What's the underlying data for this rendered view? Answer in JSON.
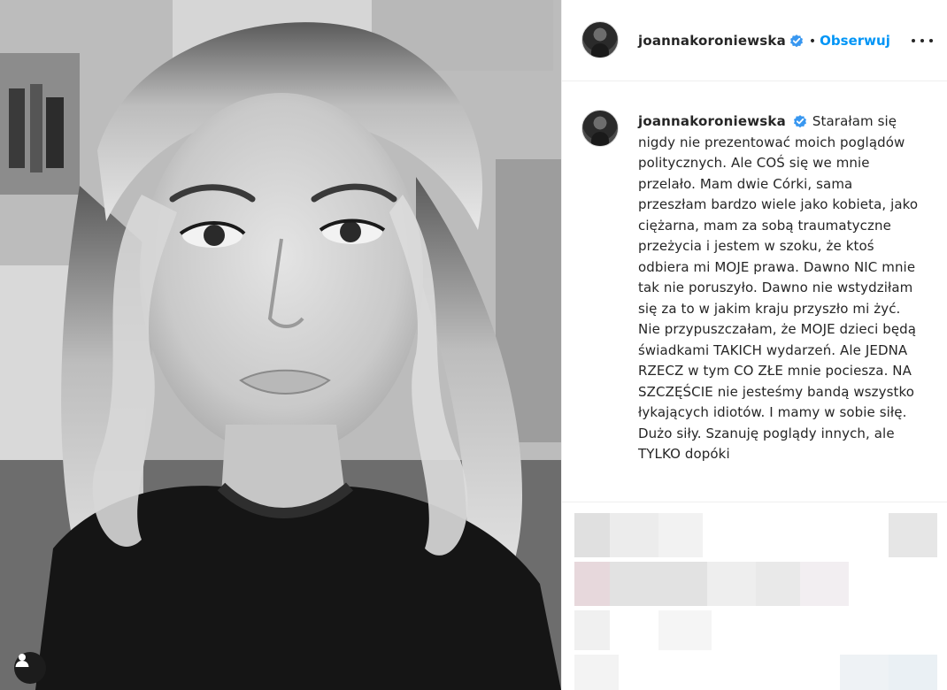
{
  "post": {
    "author": {
      "username": "joannakoroniewska",
      "verified": true
    },
    "follow_label": "Obserwuj",
    "separator": "•",
    "caption": "Starałam się nigdy nie prezentować moich poglądów politycznych. Ale COŚ się we mnie przelało. Mam dwie Córki, sama przeszłam bardzo wiele jako kobieta, jako ciężarna, mam za sobą traumatyczne przeżycia i jestem w szoku, że ktoś odbiera mi MOJE prawa. Dawno NIC mnie tak nie poruszyło. Dawno nie wstydziłam się za to w jakim kraju przyszło mi żyć. Nie przypuszczałam, że MOJE dzieci będą świadkami TAKICH wydarzeń. Ale JEDNA RZECZ w tym CO ZŁE mnie pociesza. NA SZCZĘŚCIE nie jesteśmy bandą wszystko łykających idiotów. I mamy w sobie siłę. Dużo siły. Szanuję poglądy innych, ale TYLKO dopóki"
  },
  "icons": {
    "verified": "verified-badge-icon",
    "more": "more-options-icon",
    "user_tag": "user-tag-icon"
  },
  "colors": {
    "link_blue": "#0095f6",
    "verified_blue": "#3897f0",
    "text": "#262626",
    "border": "#efefef"
  }
}
